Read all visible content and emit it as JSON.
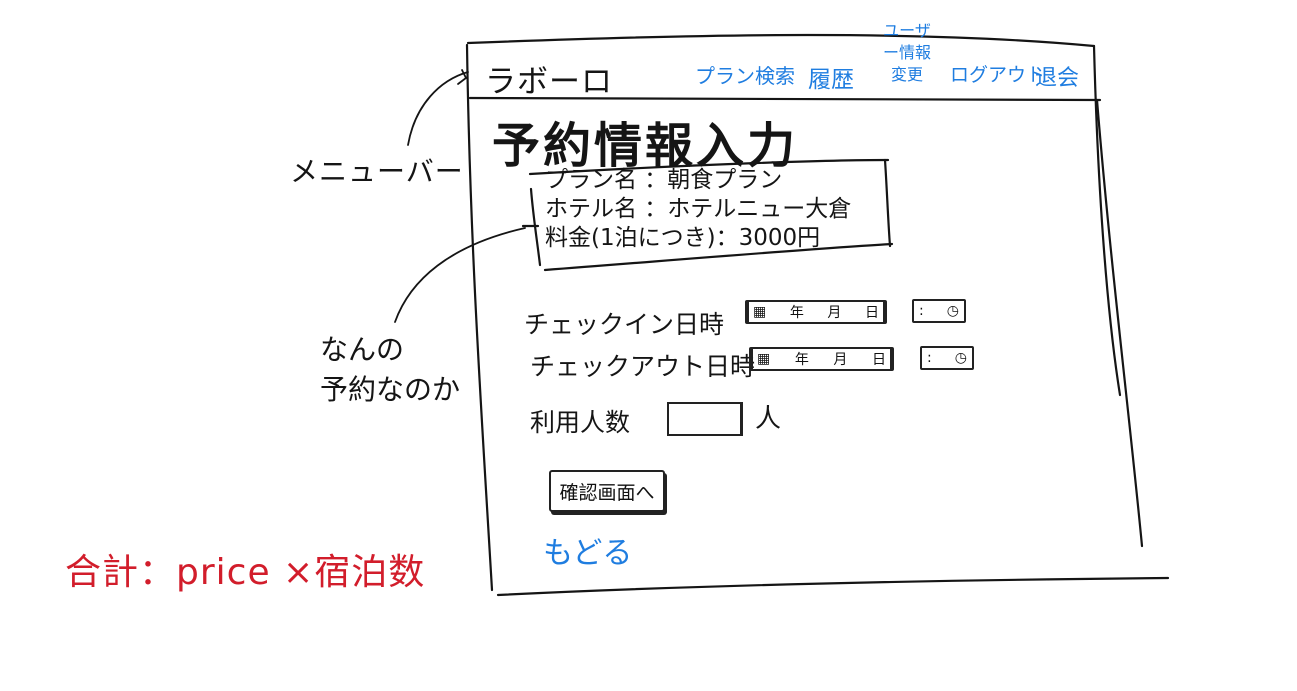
{
  "annotations": {
    "menu_bar": "メニューバー",
    "what_reservation_line1": "なんの",
    "what_reservation_line2": "予約なのか",
    "total": "合計：price ×宿泊数"
  },
  "navbar": {
    "brand": "ラボーロ",
    "items": {
      "plan_search": "プラン検索",
      "history": "履歴",
      "user_info_change": "ユーザー情報変更",
      "logout": "ログアウト",
      "withdraw": "退会"
    }
  },
  "page": {
    "title": "予約情報入力",
    "summary": {
      "plan_name": "プラン名 ：朝食プラン",
      "hotel_name": "ホテル名 ：ホテルニュー大倉",
      "price": "料金(1泊につき)：3000円"
    },
    "form": {
      "checkin_label": "チェックイン日時",
      "checkout_label": "チェックアウト日時",
      "guests_label": "利用人数",
      "guests_unit": "人",
      "date_year": "年",
      "date_month": "月",
      "date_day": "日",
      "time_separator": ":"
    },
    "confirm_button": "確認画面へ",
    "back_link": "もどる"
  },
  "colors": {
    "link_blue": "#1f7de0",
    "note_red": "#d21d2b",
    "ink": "#151515"
  },
  "icons": [
    "calendar-icon",
    "clock-icon"
  ]
}
